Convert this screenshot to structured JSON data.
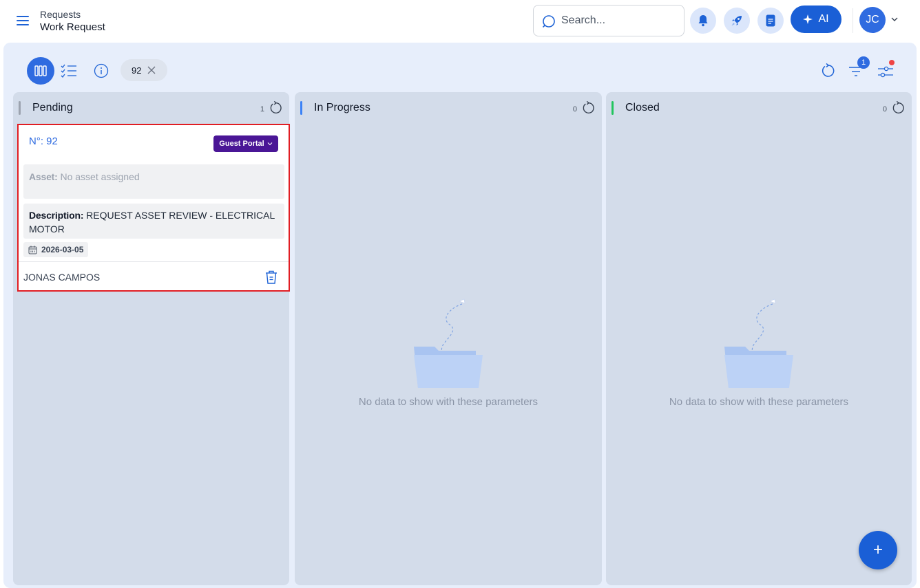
{
  "header": {
    "breadcrumb_parent": "Requests",
    "page_title": "Work Request",
    "search_placeholder": "Search...",
    "ai_label": "AI",
    "avatar_initials": "JC"
  },
  "toolbar": {
    "filter_chip_value": "92",
    "filter_badge_count": "1"
  },
  "columns": [
    {
      "title": "Pending",
      "count": "1",
      "color": "#9ca3af"
    },
    {
      "title": "In Progress",
      "count": "0",
      "color": "#3b82f6",
      "empty_text": "No data to show with these parameters"
    },
    {
      "title": "Closed",
      "count": "0",
      "color": "#22c55e",
      "empty_text": "No data to show with these parameters"
    }
  ],
  "card": {
    "number_label": "N°: 92",
    "source_tag": "Guest Portal",
    "asset_label": "Asset:",
    "asset_value": "No asset assigned",
    "description_label": "Description:",
    "description_value": "REQUEST ASSET REVIEW - ELECTRICAL MOTOR",
    "date": "2026-03-05",
    "assignee": "JONAS CAMPOS"
  },
  "fab_label": "+",
  "colors": {
    "primary": "#1a5fd6",
    "panel_bg": "#e7eefb",
    "column_bg": "#d3dcea",
    "tag_purple": "#4a1696",
    "highlight_border": "#e11d23"
  }
}
